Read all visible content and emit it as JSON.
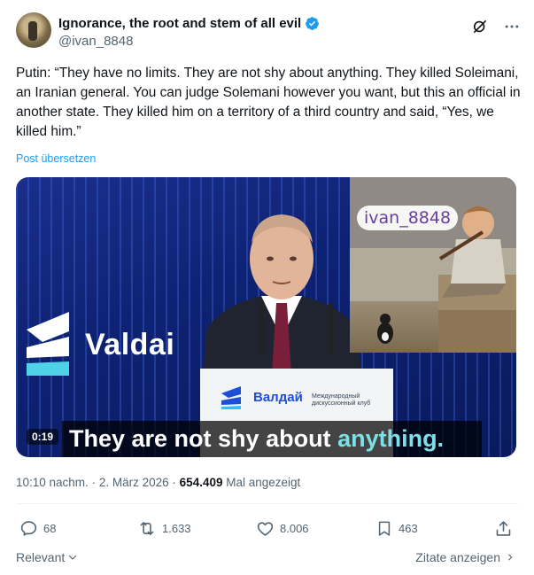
{
  "author": {
    "display_name": "Ignorance, the root and stem of all evil",
    "handle": "@ivan_8848"
  },
  "tweet": {
    "text": "Putin: “They have no limits. They are not shy about anything. They killed Soleimani, an Iranian general. You can judge Solemani however you want, but this an official in another state. They killed him on a territory of a third country and said, “Yes, we killed him.”",
    "translate_label": "Post übersetzen"
  },
  "media": {
    "backdrop_word": "Valdai",
    "podium_word": "Валдай",
    "podium_subtext": "Международный дискуссионный клуб",
    "inset_watermark": "ivan_8848",
    "timestamp": "0:19",
    "caption_start": "They are not shy about ",
    "caption_highlight": "anything."
  },
  "meta": {
    "time": "10:10 nachm.",
    "separator": "·",
    "date": "2. März 2026",
    "views": "654.409",
    "views_label": "Mal angezeigt"
  },
  "actions": {
    "replies": "68",
    "reposts": "1.633",
    "likes": "8.006",
    "bookmarks": "463"
  },
  "footer": {
    "sort_label": "Relevant",
    "quotes_label": "Zitate anzeigen"
  },
  "colors": {
    "link": "#1d9bf0",
    "muted": "#536471",
    "verified": "#1d9bf0"
  },
  "icons": [
    "verified-icon",
    "grok-icon",
    "more-icon",
    "reply-icon",
    "repost-icon",
    "like-icon",
    "bookmark-icon",
    "share-icon",
    "chevron-down-icon",
    "chevron-right-icon"
  ]
}
